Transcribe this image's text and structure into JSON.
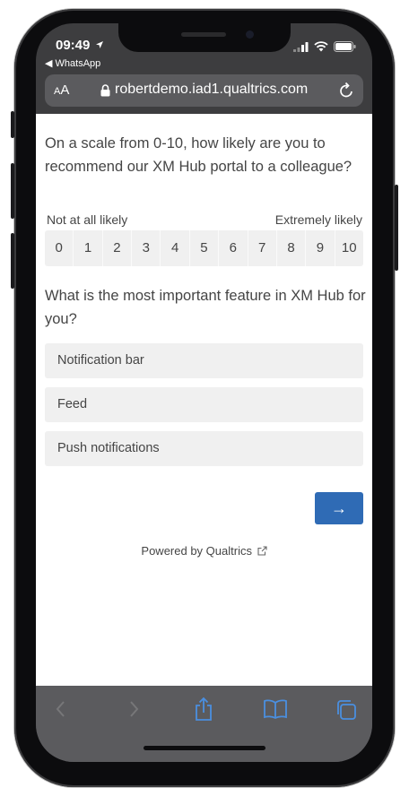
{
  "status_bar": {
    "time": "09:49",
    "back_app": "◀ WhatsApp"
  },
  "browser": {
    "text_size": "AA",
    "url": "robertdemo.iad1.qualtrics.com"
  },
  "survey": {
    "question1": "On a scale from 0-10, how likely are you to recommend our XM Hub portal to a colleague?",
    "label_low": "Not at all likely",
    "label_high": "Extremely likely",
    "scale": [
      "0",
      "1",
      "2",
      "3",
      "4",
      "5",
      "6",
      "7",
      "8",
      "9",
      "10"
    ],
    "question2": "What is the most important feature in XM Hub for you?",
    "options": [
      "Notification bar",
      "Feed",
      "Push notifications"
    ],
    "next_button": "→",
    "powered_by": "Powered by Qualtrics"
  },
  "colors": {
    "accent": "#2f6bb5",
    "toolbar_icons": "#4a8fe0",
    "chrome": "#5b5b5e"
  },
  "icons": {
    "location": "location-arrow-icon",
    "signal": "signal-icon",
    "wifi": "wifi-icon",
    "battery": "battery-icon",
    "lock": "lock-icon",
    "reload": "reload-icon",
    "external_link": "external-link-icon",
    "back": "back-arrow-icon",
    "forward": "forward-arrow-icon",
    "share": "share-icon",
    "bookmarks": "bookmarks-icon",
    "tabs": "tabs-icon"
  }
}
